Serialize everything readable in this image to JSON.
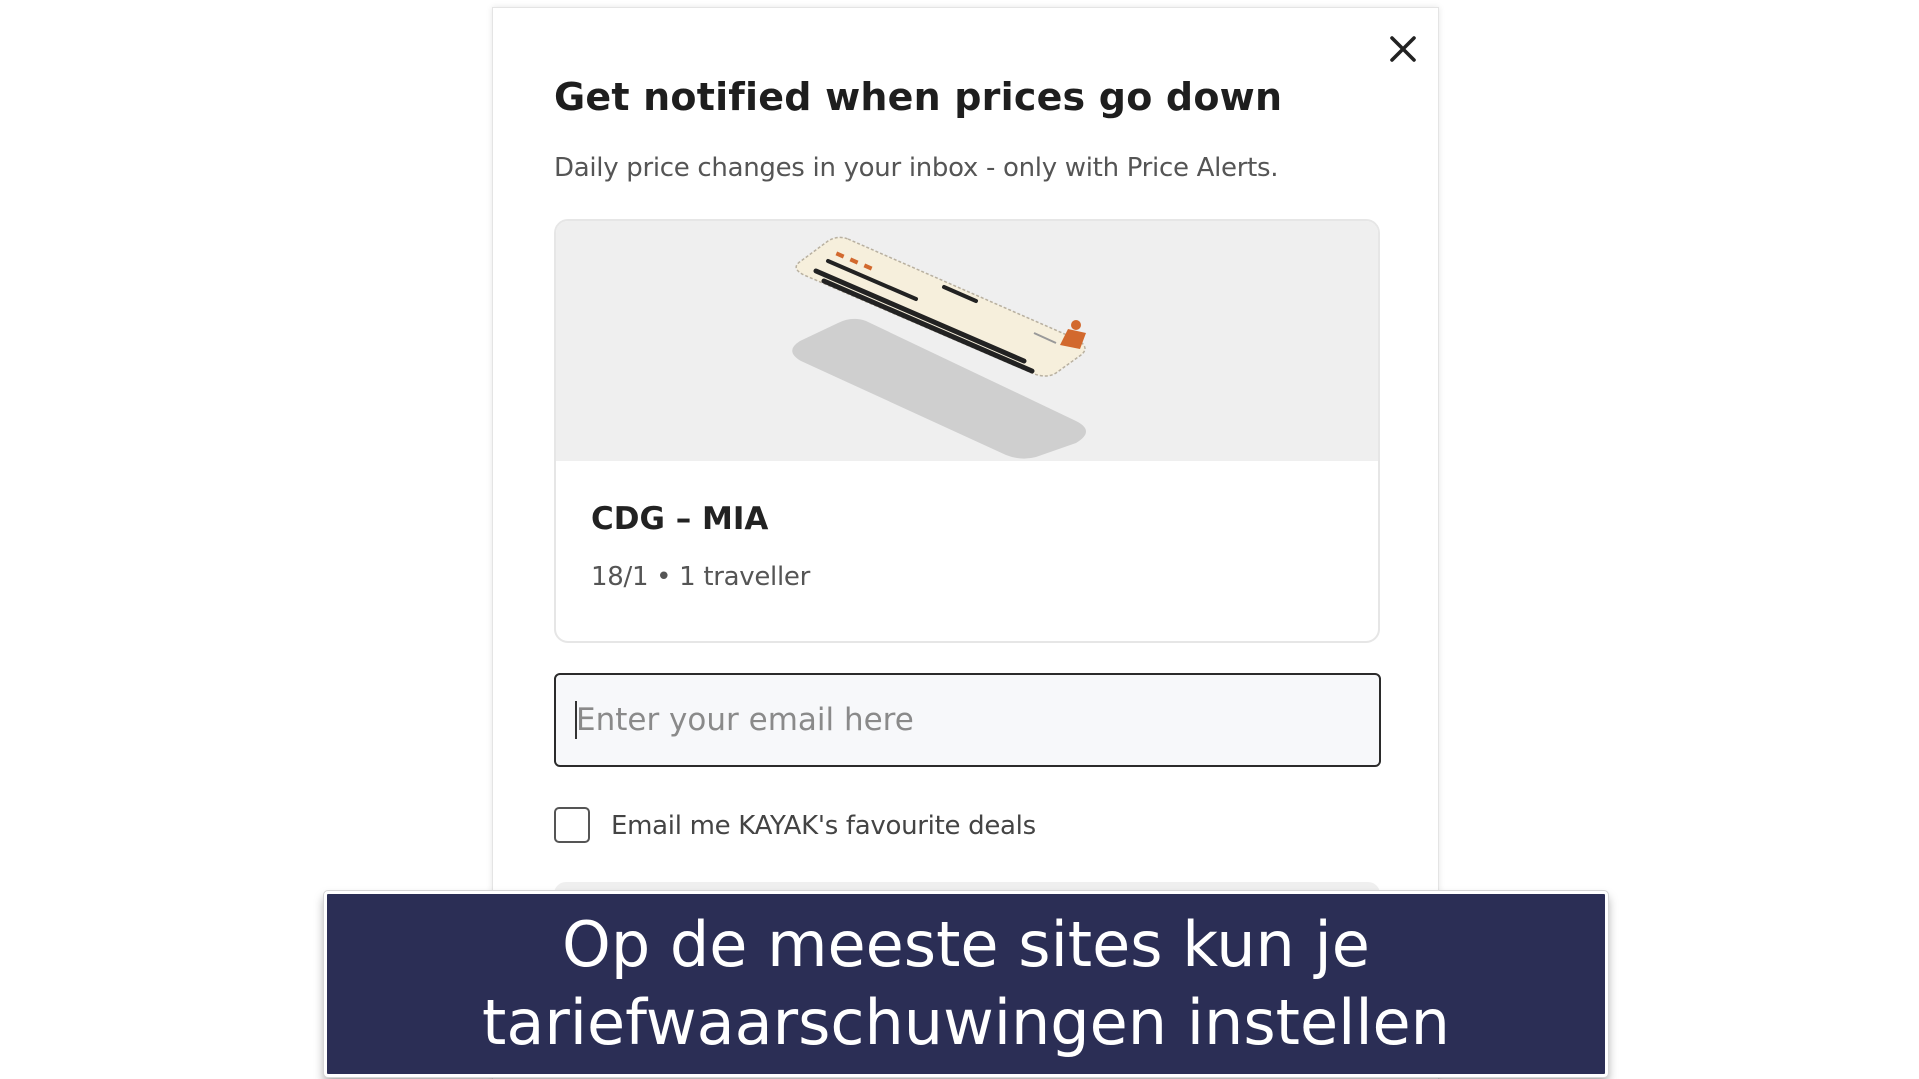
{
  "modal": {
    "close_icon": "close-icon",
    "title": "Get notified when prices go down",
    "subtitle": "Daily price changes in your inbox - only with Price Alerts.",
    "card": {
      "illustration": "price-alert-ticket-illustration",
      "route": "CDG – MIA",
      "details": "18/1 • 1 traveller"
    },
    "email": {
      "placeholder": "Enter your email here",
      "value": ""
    },
    "checkbox": {
      "label": "Email me KAYAK's favourite deals",
      "checked": false
    }
  },
  "caption": {
    "line1": "Op de meeste sites kun je",
    "line2": "tariefwaarschuwingen instellen"
  },
  "colors": {
    "caption_bg": "#2b2e55",
    "illustration_bg": "#efefef",
    "accent_orange": "#d2692e"
  }
}
